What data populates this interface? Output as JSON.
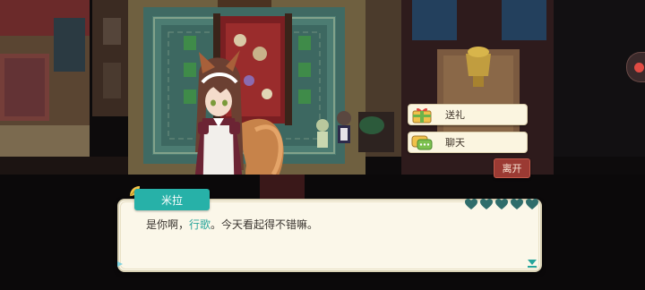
{
  "dialog": {
    "speaker": "米拉",
    "text_before": "是你啊，",
    "text_highlight": "行歌",
    "text_after": "。今天看起得不错嘛。",
    "highlight_color": "#27a59b"
  },
  "affection": {
    "filled_hearts": 5,
    "max_hearts": 5,
    "heart_color": "#2f6d6b"
  },
  "choices": [
    {
      "label": "送礼",
      "icon": "gift-icon"
    },
    {
      "label": "聊天",
      "icon": "chat-bubble-icon"
    }
  ],
  "leave_label": "离开",
  "colors": {
    "name_tab": "#27b1a8",
    "leave_button": "#9b3a33",
    "dialog_bg": "#fbf7e9"
  }
}
